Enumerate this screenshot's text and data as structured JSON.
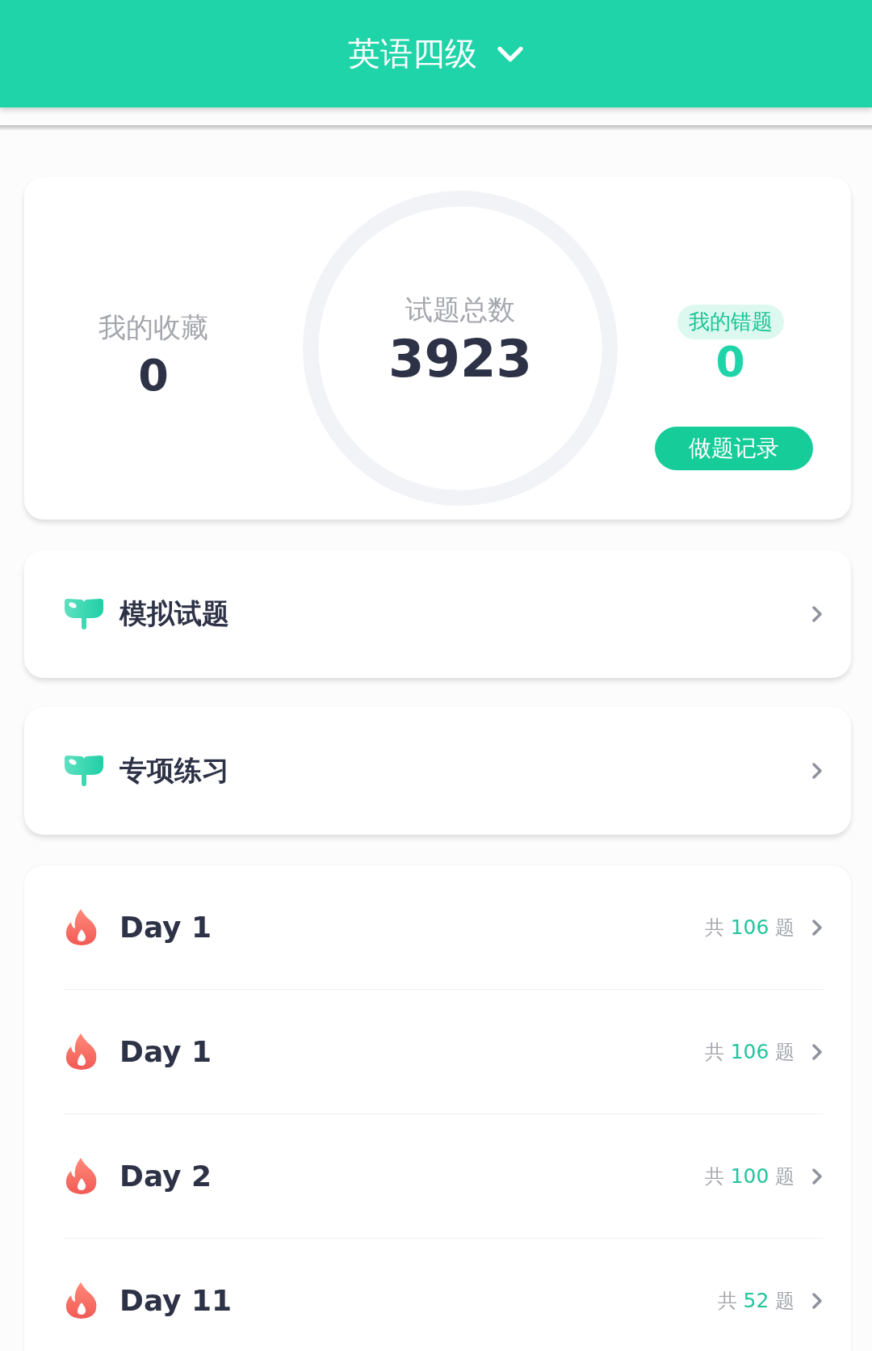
{
  "header": {
    "title": "英语四级"
  },
  "stats": {
    "favorites": {
      "label": "我的收藏",
      "value": "0"
    },
    "total": {
      "label": "试题总数",
      "value": "3923"
    },
    "wrong": {
      "label": "我的错题",
      "value": "0"
    },
    "record_button": "做题记录"
  },
  "menu": [
    {
      "label": "模拟试题"
    },
    {
      "label": "专项练习"
    }
  ],
  "days": [
    {
      "title": "Day 1",
      "prefix": "共",
      "count": "106",
      "suffix": "题"
    },
    {
      "title": "Day 1",
      "prefix": "共",
      "count": "106",
      "suffix": "题"
    },
    {
      "title": "Day 2",
      "prefix": "共",
      "count": "100",
      "suffix": "题"
    },
    {
      "title": "Day 11",
      "prefix": "共",
      "count": "52",
      "suffix": "题"
    }
  ]
}
